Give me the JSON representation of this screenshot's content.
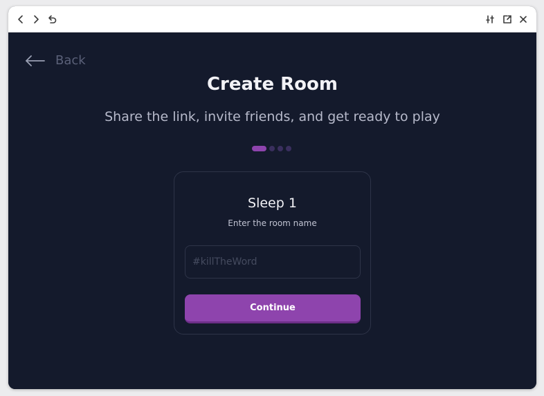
{
  "toolbar": {
    "icons": [
      "chevron-left-icon",
      "chevron-right-icon",
      "undo-icon",
      "sliders-icon",
      "open-external-icon",
      "close-icon"
    ]
  },
  "nav": {
    "back_label": "Back"
  },
  "header": {
    "title": "Create Room",
    "subtitle": "Share the link, invite friends, and get ready to play"
  },
  "steps": {
    "current": 1,
    "total": 4
  },
  "card": {
    "title": "Sleep 1",
    "subtitle": "Enter the room name",
    "input_placeholder": "#killTheWord",
    "input_value": "",
    "button_label": "Continue"
  },
  "colors": {
    "background": "#141a2c",
    "accent": "#8e44ad",
    "inactive_dot": "#3a2f5e",
    "border": "#2e3448"
  }
}
